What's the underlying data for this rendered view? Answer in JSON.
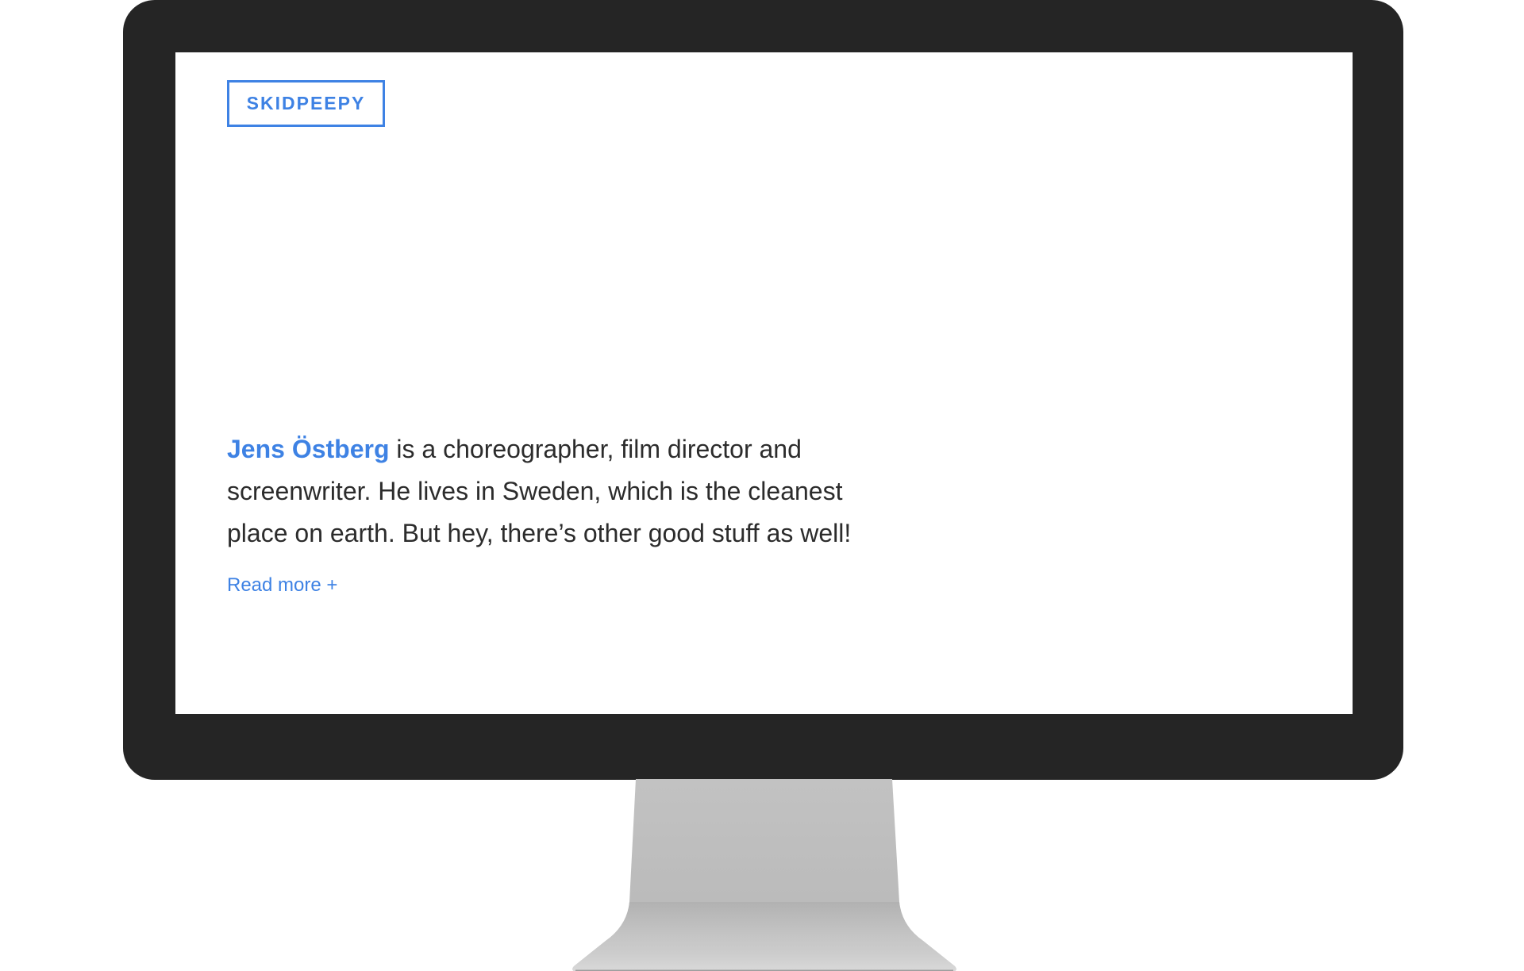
{
  "site": {
    "logo_text": "SKIDPEEPY"
  },
  "intro": {
    "name": "Jens Östberg",
    "text": " is a choreographer, film director and screenwriter. He lives in Sweden, which is the cleanest place on earth. But hey, there’s other good stuff as well!"
  },
  "links": {
    "read_more": "Read more +"
  },
  "colors": {
    "accent": "#3e82e4",
    "body_text": "#2c2c2c",
    "bezel": "#252525",
    "stand": "#bdbdbd"
  }
}
